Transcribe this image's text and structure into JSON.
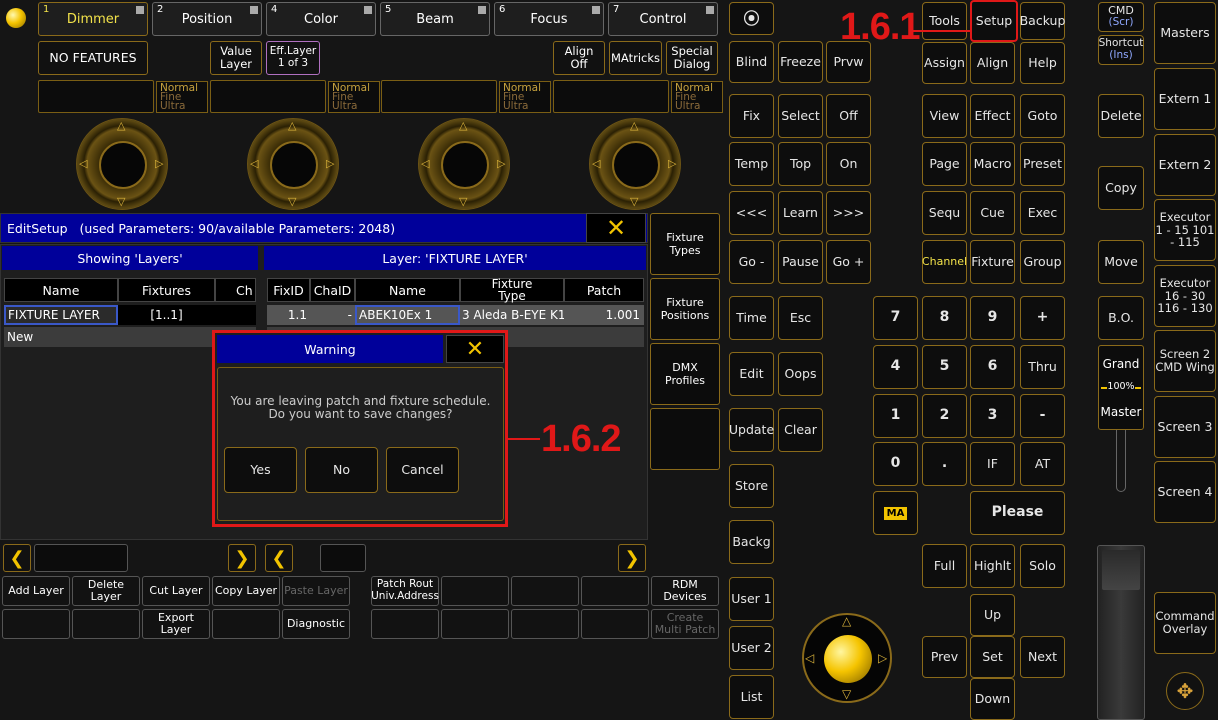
{
  "encoder_tabs": [
    {
      "num": "1",
      "label": "Dimmer",
      "active": true
    },
    {
      "num": "2",
      "label": "Position"
    },
    {
      "num": "4",
      "label": "Color"
    },
    {
      "num": "5",
      "label": "Beam"
    },
    {
      "num": "6",
      "label": "Focus"
    },
    {
      "num": "7",
      "label": "Control"
    }
  ],
  "feature_bar": {
    "no_features": "NO FEATURES",
    "value_layer": "Value Layer",
    "eff_layer": "Eff.Layer",
    "eff_layer_sub": "1 of 3",
    "align": "Align",
    "align_sub": "Off",
    "matricks": "MAtricks",
    "special": "Special",
    "special_sub": "Dialog"
  },
  "mode_label": {
    "l1": "Normal",
    "l2": "Fine",
    "l3": "Ultra"
  },
  "edit_setup": {
    "title": "EditSetup",
    "info": "(used Parameters: 90/available Parameters: 2048)",
    "left_header": "Showing 'Layers'",
    "right_header": "Layer: 'FIXTURE LAYER'",
    "left_columns": [
      "Name",
      "Fixtures",
      "Ch"
    ],
    "left_rows": [
      [
        "FIXTURE LAYER",
        "[1..1]",
        ""
      ],
      [
        "New",
        "",
        ""
      ]
    ],
    "right_columns": [
      "FixID",
      "ChaID",
      "Name",
      "Fixture Type",
      "Patch"
    ],
    "right_rows": [
      [
        "1.1",
        "-",
        "ABEK10Ex 1",
        "3 Aleda B-EYE K1",
        "1.001"
      ]
    ]
  },
  "side_panel": {
    "fixture_types": "Fixture Types",
    "fixture_positions": "Fixture Positions",
    "dmx_profiles": "DMX Profiles"
  },
  "bottom_bar": {
    "add_layer": "Add Layer",
    "delete_layer": "Delete Layer",
    "cut_layer": "Cut Layer",
    "copy_layer": "Copy Layer",
    "paste_layer": "Paste Layer",
    "patch_rout": "Patch Rout Univ.Address",
    "rdm_devices": "RDM Devices",
    "export_layer": "Export Layer",
    "diagnostic": "Diagnostic",
    "create_multi_patch": "Create Multi Patch"
  },
  "warning": {
    "title": "Warning",
    "message_line1": "You are leaving patch and fixture schedule.",
    "message_line2": "Do you want to save changes?",
    "yes": "Yes",
    "no": "No",
    "cancel": "Cancel"
  },
  "annotations": {
    "a1": "1.6.1",
    "a2": "1.6.2"
  },
  "console_left_col": [
    "Blind",
    "Fix",
    "Temp",
    "<<<",
    "Go -",
    "Time",
    "Edit",
    "Update",
    "Store",
    "Backg",
    "User 1",
    "User 2",
    "List"
  ],
  "console_keys": {
    "freeze": "Freeze",
    "prvw": "Prvw",
    "select": "Select",
    "off": "Off",
    "top": "Top",
    "on": "On",
    "learn": "Learn",
    "fwd": ">>>",
    "pause": "Pause",
    "goplus": "Go +",
    "esc": "Esc",
    "oops": "Oops",
    "clear": "Clear",
    "tools": "Tools",
    "setup": "Setup",
    "backup": "Backup",
    "assign": "Assign",
    "align": "Align",
    "help": "Help",
    "view": "View",
    "effect": "Effect",
    "goto": "Goto",
    "page": "Page",
    "macro": "Macro",
    "preset": "Preset",
    "sequ": "Sequ",
    "cue": "Cue",
    "exec": "Exec",
    "channel": "Channel",
    "fixture": "Fixture",
    "group": "Group",
    "n7": "7",
    "n8": "8",
    "n9": "9",
    "plus": "+",
    "n4": "4",
    "n5": "5",
    "n6": "6",
    "thru": "Thru",
    "n1": "1",
    "n2": "2",
    "n3": "3",
    "minus": "-",
    "n0": "0",
    "dot": ".",
    "if": "IF",
    "at": "AT",
    "please": "Please",
    "full": "Full",
    "highlt": "Highlt",
    "solo": "Solo",
    "up": "Up",
    "prev": "Prev",
    "set": "Set",
    "next": "Next",
    "down": "Down",
    "ma": "MA"
  },
  "right_col": {
    "cmd": "CMD",
    "cmd_sub": "(Scr)",
    "shortcut": "Shortcut",
    "shortcut_sub": "(Ins)",
    "delete": "Delete",
    "copy": "Copy",
    "move": "Move",
    "bo": "B.O.",
    "grand": "Grand",
    "grand_pct": "100%",
    "master": "Master"
  },
  "far_right": [
    "Masters",
    "Extern 1",
    "Extern 2",
    "Executor 1 - 15 101 - 115",
    "Executor 16 - 30 116 - 130",
    "Screen 2 CMD Wing",
    "Screen 3",
    "Screen 4",
    "Command Overlay"
  ]
}
